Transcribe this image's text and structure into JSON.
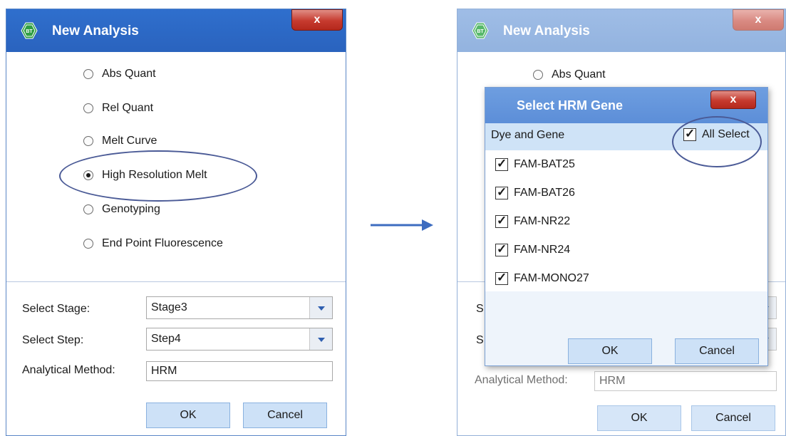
{
  "left_dialog": {
    "title": "New Analysis",
    "close_label": "x",
    "radio_options": [
      {
        "label": "Abs Quant",
        "selected": false
      },
      {
        "label": "Rel Quant",
        "selected": false
      },
      {
        "label": "Melt Curve",
        "selected": false
      },
      {
        "label": "High Resolution Melt",
        "selected": true
      },
      {
        "label": "Genotyping",
        "selected": false
      },
      {
        "label": "End Point Fluorescence",
        "selected": false
      }
    ],
    "select_stage_label": "Select Stage:",
    "select_stage_value": "Stage3",
    "select_step_label": "Select Step:",
    "select_step_value": "Step4",
    "analytical_method_label": "Analytical Method:",
    "analytical_method_value": "HRM",
    "ok_label": "OK",
    "cancel_label": "Cancel"
  },
  "right_dialog": {
    "title": "New Analysis",
    "close_label": "x",
    "radio_visible_label": "Abs Quant",
    "analytical_method_label": "Analytical Method:",
    "analytical_method_value": "HRM",
    "ok_label": "OK",
    "cancel_label": "Cancel",
    "partial_label_stage": "S",
    "partial_label_step": "S"
  },
  "hrm_dialog": {
    "title": "Select HRM Gene",
    "close_label": "x",
    "header_label": "Dye and Gene",
    "all_select_label": "All Select",
    "all_select_checked": true,
    "genes": [
      {
        "label": "FAM-BAT25",
        "checked": true
      },
      {
        "label": "FAM-BAT26",
        "checked": true
      },
      {
        "label": "FAM-NR22",
        "checked": true
      },
      {
        "label": "FAM-NR24",
        "checked": true
      },
      {
        "label": "FAM-MONO27",
        "checked": true
      }
    ],
    "ok_label": "OK",
    "cancel_label": "Cancel"
  },
  "colors": {
    "title_bar": "#2f6fcd",
    "close_button": "#c63a2e",
    "annotation": "#4a5a96",
    "arrow": "#3d6cc0",
    "button_fill": "#cde1f7",
    "header_fill": "#cfe3f7"
  }
}
